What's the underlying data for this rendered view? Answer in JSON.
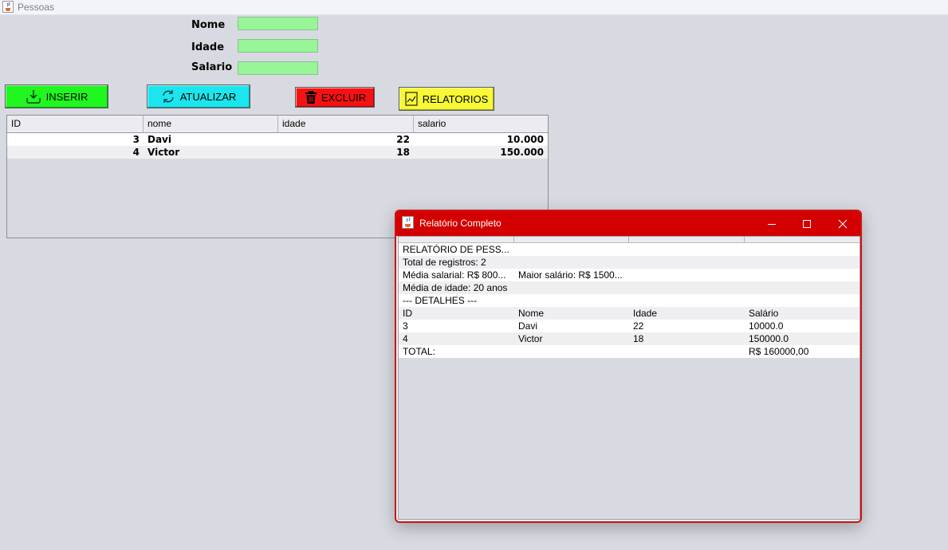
{
  "window": {
    "title": "Pessoas"
  },
  "form": {
    "nome_label": "Nome",
    "idade_label": "Idade",
    "salario_label": "Salario",
    "nome_value": "",
    "idade_value": "",
    "salario_value": ""
  },
  "buttons": {
    "inserir": "INSERIR",
    "atualizar": "ATUALIZAR",
    "excluir": "EXCLUIR",
    "relatorios": "RELATORIOS"
  },
  "colors": {
    "inserir": "#1ff71f",
    "atualizar": "#1be6ee",
    "excluir": "#f61212",
    "relatorios": "#f8f834",
    "dialog_accent": "#d40000"
  },
  "table": {
    "columns": [
      "ID",
      "nome",
      "idade",
      "salario"
    ],
    "rows": [
      {
        "id": "3",
        "nome": "Davi",
        "idade": "22",
        "salario": "10.000"
      },
      {
        "id": "4",
        "nome": "Victor",
        "idade": "18",
        "salario": "150.000"
      }
    ]
  },
  "dialog": {
    "title": "Relatório Completo",
    "report": [
      [
        "RELATÓRIO DE PESS...",
        "",
        "",
        ""
      ],
      [
        "Total de registros: 2",
        "",
        "",
        ""
      ],
      [
        "Média salarial: R$ 800...",
        "Maior salário: R$ 1500...",
        "",
        ""
      ],
      [
        "Média de idade: 20 anos",
        "",
        "",
        ""
      ],
      [
        "--- DETALHES ---",
        "",
        "",
        ""
      ],
      [
        "ID",
        "Nome",
        "Idade",
        "Salário"
      ],
      [
        "3",
        "Davi",
        "22",
        "10000.0"
      ],
      [
        "4",
        "Victor",
        "18",
        "150000.0"
      ],
      [
        "TOTAL:",
        "",
        "",
        "R$ 160000,00"
      ]
    ]
  }
}
